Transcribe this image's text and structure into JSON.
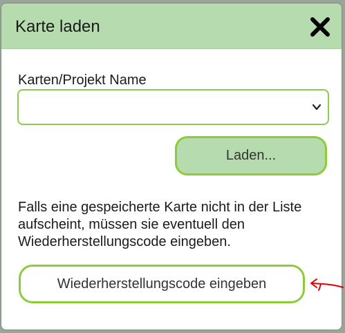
{
  "dialog": {
    "title": "Karte laden",
    "close_icon": "close-icon"
  },
  "form": {
    "field_label": "Karten/Projekt Name",
    "select_value": "",
    "load_button": "Laden...",
    "info_text": "Falls eine gespeicherte Karte nicht in der Liste aufscheint, müssen sie eventuell den Wiederherstellungscode eingeben.",
    "code_button": "Wiederherstellungscode eingeben"
  },
  "colors": {
    "header_bg": "#b5dbaf",
    "accent_border": "#8ccc3a",
    "annotation_arrow": "#e00000"
  }
}
